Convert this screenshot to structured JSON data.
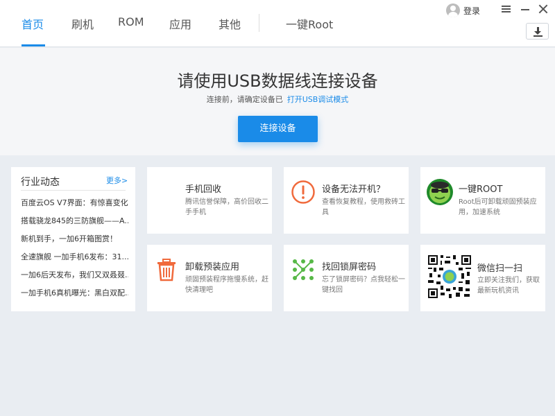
{
  "header": {
    "tabs": [
      {
        "label": "首页",
        "active": true
      },
      {
        "label": "刷机",
        "active": false
      },
      {
        "label": "ROM",
        "active": false
      },
      {
        "label": "应用",
        "active": false
      },
      {
        "label": "其他",
        "active": false
      },
      {
        "label": "一键Root",
        "active": false
      }
    ],
    "login_label": "登录",
    "accent_color": "#1a8be8"
  },
  "hero": {
    "title": "请使用USB数据线连接设备",
    "subtitle": "连接前，请确定设备已",
    "subtitle_link": "打开USB调试模式",
    "connect_button": "连接设备"
  },
  "news": {
    "title": "行业动态",
    "more": "更多>",
    "items": [
      "百度云OS V7界面：有惊喜变化",
      "搭载骁龙845的三防旗舰——A...",
      "新机到手，一加6开箱图赏！",
      "全速旗舰 一加手机6发布：31...",
      "一加6后天发布，我们又双叒叕...",
      "一加手机6真机曝光：黑白双配..."
    ]
  },
  "cards": {
    "recycle": {
      "title": "手机回收",
      "desc": "腾讯信誉保障，高价回收二手手机",
      "icon": "phone-recycle-icon"
    },
    "no_boot": {
      "title": "设备无法开机？",
      "desc": "查看恢复教程，使用救砖工具",
      "icon": "warning-icon"
    },
    "root": {
      "title": "一键ROOT",
      "desc": "Root后可卸载顽固预装应用，加速系统",
      "icon": "root-mascot-icon"
    },
    "uninstall": {
      "title": "卸载预装应用",
      "desc": "顽固预装程序拖慢系统，赶快清理吧",
      "icon": "trash-icon"
    },
    "unlock": {
      "title": "找回锁屏密码",
      "desc": "忘了锁屏密码？点我轻松一键找回",
      "icon": "pattern-lock-icon"
    },
    "wechat": {
      "title": "微信扫一扫",
      "desc": "立即关注我们，获取最新玩机资讯",
      "icon": "qr-code-icon"
    }
  },
  "colors": {
    "warning": "#f06a3c",
    "trash": "#f06a3c",
    "pattern": "#57b847",
    "root_green": "#3aa53a"
  }
}
